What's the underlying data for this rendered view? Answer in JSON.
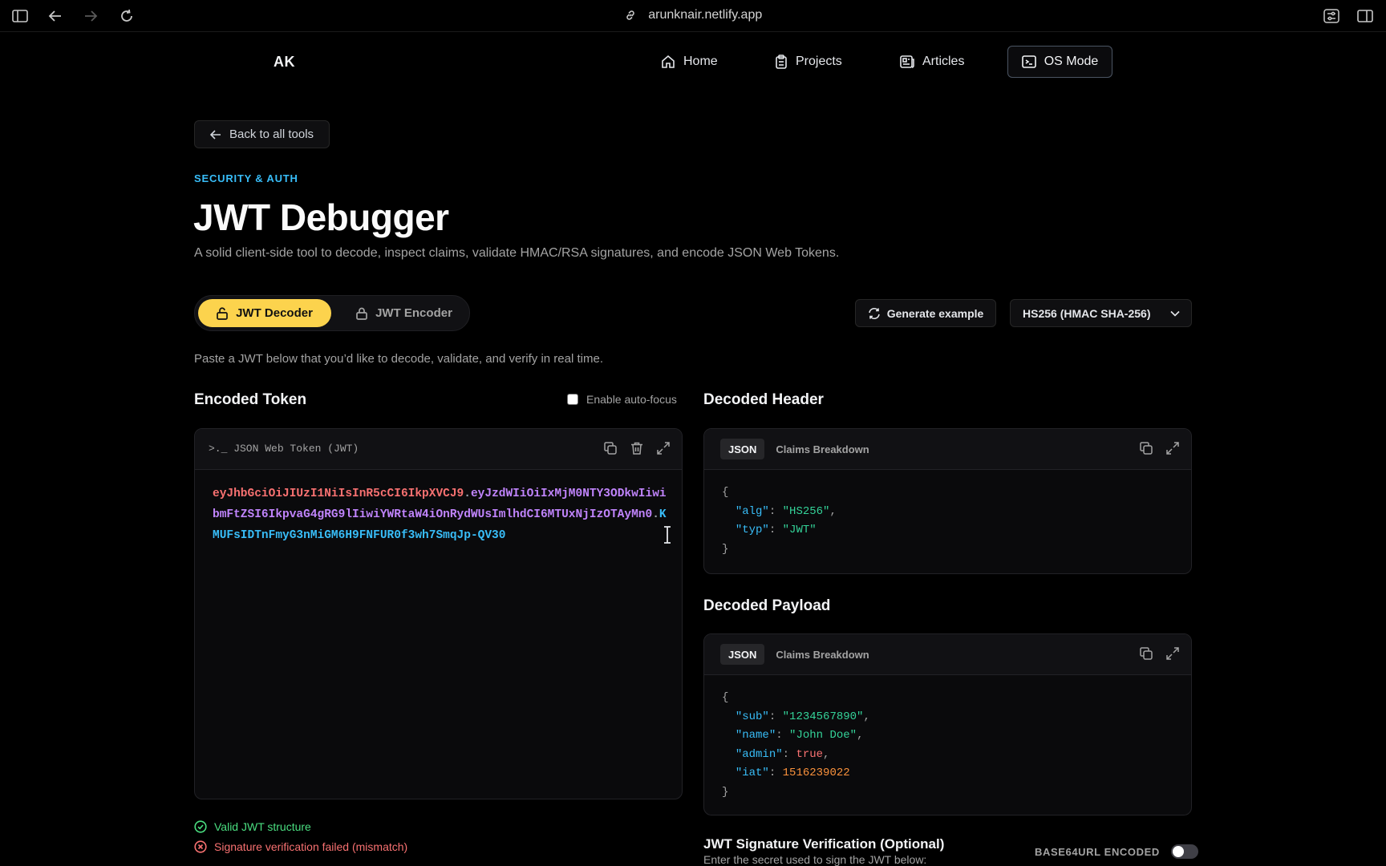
{
  "browser": {
    "url": "arunknair.netlify.app"
  },
  "site": {
    "logo": "AK",
    "nav": [
      {
        "label": "Home",
        "icon": "home-icon"
      },
      {
        "label": "Projects",
        "icon": "clipboard-icon"
      },
      {
        "label": "Articles",
        "icon": "newspaper-icon"
      },
      {
        "label": "OS Mode",
        "icon": "terminal-icon"
      }
    ]
  },
  "page": {
    "back_label": "Back to all tools",
    "eyebrow": "SECURITY & AUTH",
    "title": "JWT Debugger",
    "subtitle": "A solid client-side tool to decode, inspect claims, validate HMAC/RSA signatures, and encode JSON Web Tokens.",
    "intro": "Paste a JWT below that you’d like to decode, validate, and verify in real time."
  },
  "modes": {
    "decoder": "JWT Decoder",
    "encoder": "JWT Encoder",
    "active": "decoder"
  },
  "actions": {
    "generate": "Generate example",
    "algorithm": "HS256 (HMAC SHA-256)"
  },
  "encoded": {
    "title": "Encoded Token",
    "autofocus_label": "Enable auto-focus",
    "autofocus_checked": false,
    "panel_label": ">._ JSON Web Token (JWT)",
    "header_part": "eyJhbGciOiJIUzI1NiIsInR5cCI6IkpXVCJ9",
    "payload_part": "eyJzdWIiOiIxMjM0NTY3ODkwIiwibmFtZSI6IkpvaG4gRG9lIiwiYWRtaW4iOnRydWUsImlhdCI6MTUxNjIzOTAyMn0",
    "signature_part": "KMUFsIDTnFmyG3nMiGM6H9FNFUR0f3wh7SmqJp-QV30",
    "separator": "."
  },
  "decoded_header": {
    "title": "Decoded Header",
    "tabs": [
      "JSON",
      "Claims Breakdown"
    ],
    "active_tab": "JSON",
    "fields": [
      {
        "key": "\"alg\"",
        "value": "\"HS256\"",
        "type": "str"
      },
      {
        "key": "\"typ\"",
        "value": "\"JWT\"",
        "type": "str"
      }
    ]
  },
  "decoded_payload": {
    "title": "Decoded Payload",
    "tabs": [
      "JSON",
      "Claims Breakdown"
    ],
    "active_tab": "JSON",
    "fields": [
      {
        "key": "\"sub\"",
        "value": "\"1234567890\"",
        "type": "str"
      },
      {
        "key": "\"name\"",
        "value": "\"John Doe\"",
        "type": "str"
      },
      {
        "key": "\"admin\"",
        "value": "true",
        "type": "bool"
      },
      {
        "key": "\"iat\"",
        "value": "1516239022",
        "type": "num"
      }
    ]
  },
  "status": {
    "valid": "Valid JWT structure",
    "invalid": "Signature verification failed (mismatch)"
  },
  "signature": {
    "title": "JWT Signature Verification (Optional)",
    "subtitle": "Enter the secret used to sign the JWT below:",
    "base64_label": "BASE64URL ENCODED",
    "base64_enabled": false
  },
  "colors": {
    "accent_yellow": "#fcd34d",
    "header_red": "#f87171",
    "payload_purple": "#c084fc",
    "signature_blue": "#38bdf8",
    "ok_green": "#4ade80"
  }
}
